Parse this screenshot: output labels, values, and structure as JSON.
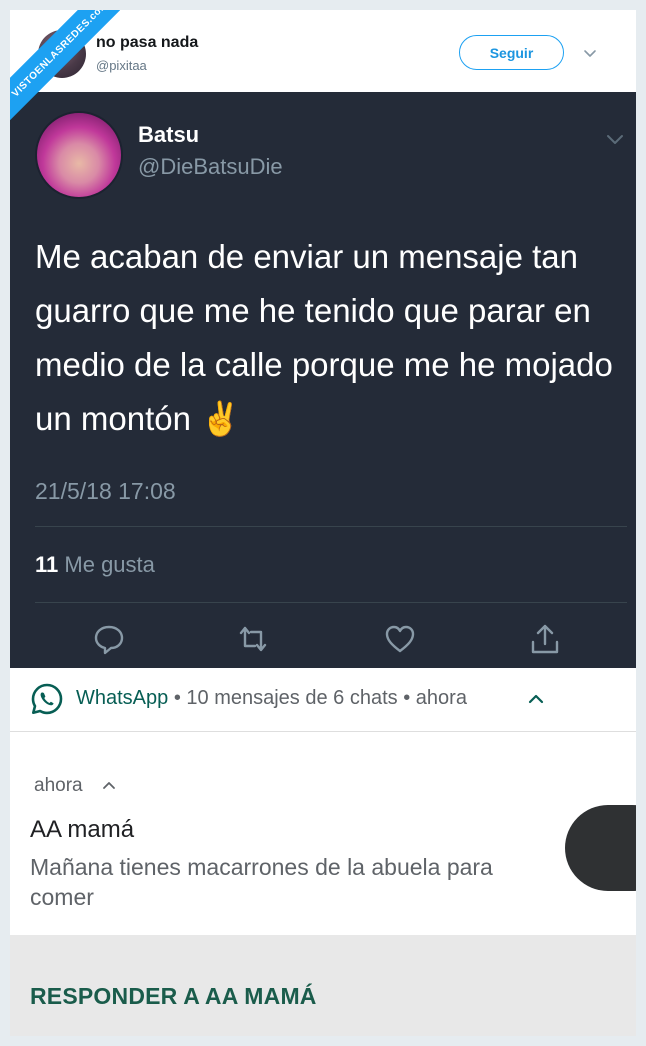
{
  "watermark": {
    "text": "VISTOENLASREDES.com"
  },
  "outer_tweet": {
    "name": "no pasa nada",
    "handle": "@pixitaa",
    "follow_label": "Seguir"
  },
  "quoted_tweet": {
    "name": "Batsu",
    "handle": "@DieBatsuDie",
    "text": "Me acaban de enviar un mensaje tan guarro que me he tenido que parar en medio de la calle porque me he mojado un montón ✌️",
    "date": "21/5/18 17:08",
    "likes_count": "11",
    "likes_label": "Me gusta"
  },
  "whatsapp_bar": {
    "app_name": "WhatsApp",
    "summary": "10 mensajes de 6 chats",
    "time": "ahora",
    "separator": "•"
  },
  "notification": {
    "time": "ahora",
    "sender": "AA mamá",
    "message": "Mañana tienes macarrones de la abuela para comer",
    "reply_label": "RESPONDER A AA MAMÁ"
  },
  "colors": {
    "dark_bg": "#242b38",
    "twitter_blue": "#1da1f2",
    "whatsapp_green": "#075e54",
    "reply_green": "#1a5c4b"
  }
}
